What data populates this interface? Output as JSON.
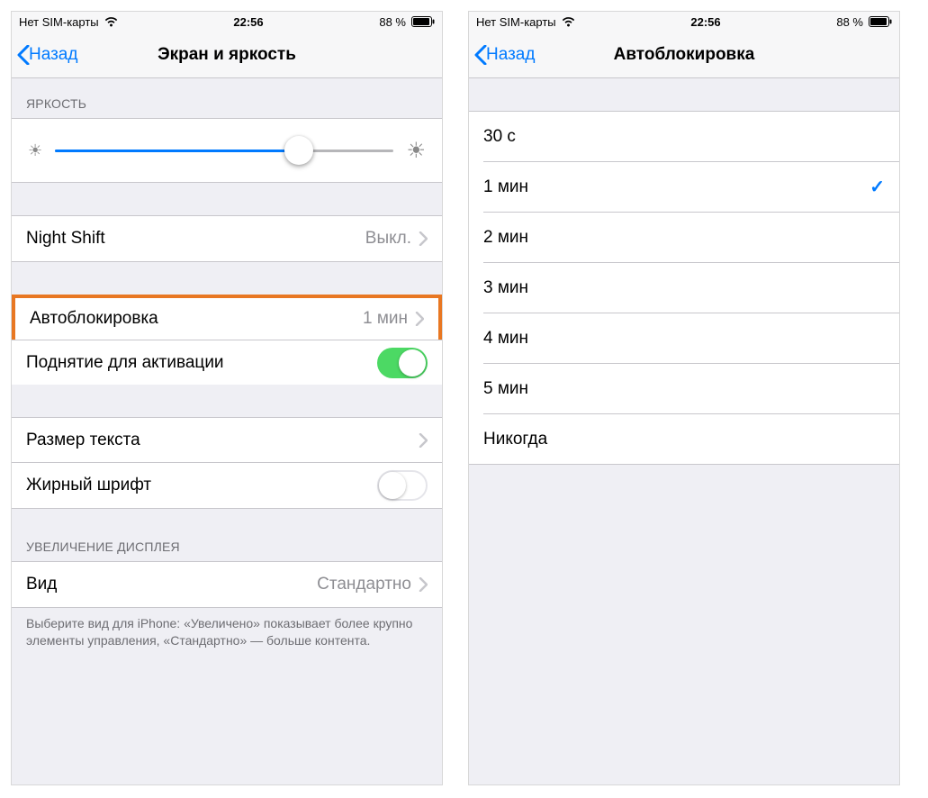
{
  "status": {
    "carrier": "Нет SIM-карты",
    "time": "22:56",
    "battery_text": "88 %"
  },
  "left_screen": {
    "back_label": "Назад",
    "title": "Экран и яркость",
    "brightness_header": "ЯРКОСТЬ",
    "brightness_percent": 72,
    "night_shift": {
      "label": "Night Shift",
      "value": "Выкл."
    },
    "autolock": {
      "label": "Автоблокировка",
      "value": "1 мин"
    },
    "raise_to_wake": {
      "label": "Поднятие для активации",
      "on": true
    },
    "text_size": {
      "label": "Размер текста"
    },
    "bold_text": {
      "label": "Жирный шрифт",
      "on": false
    },
    "display_zoom_header": "УВЕЛИЧЕНИЕ ДИСПЛЕЯ",
    "view": {
      "label": "Вид",
      "value": "Стандартно"
    },
    "footer": "Выберите вид для iPhone: «Увеличено» показывает более крупно элементы управления, «Стандартно» — больше контента."
  },
  "right_screen": {
    "back_label": "Назад",
    "title": "Автоблокировка",
    "options": [
      {
        "label": "30 с",
        "selected": false
      },
      {
        "label": "1 мин",
        "selected": true
      },
      {
        "label": "2 мин",
        "selected": false
      },
      {
        "label": "3 мин",
        "selected": false
      },
      {
        "label": "4 мин",
        "selected": false
      },
      {
        "label": "5 мин",
        "selected": false
      },
      {
        "label": "Никогда",
        "selected": false
      }
    ]
  }
}
